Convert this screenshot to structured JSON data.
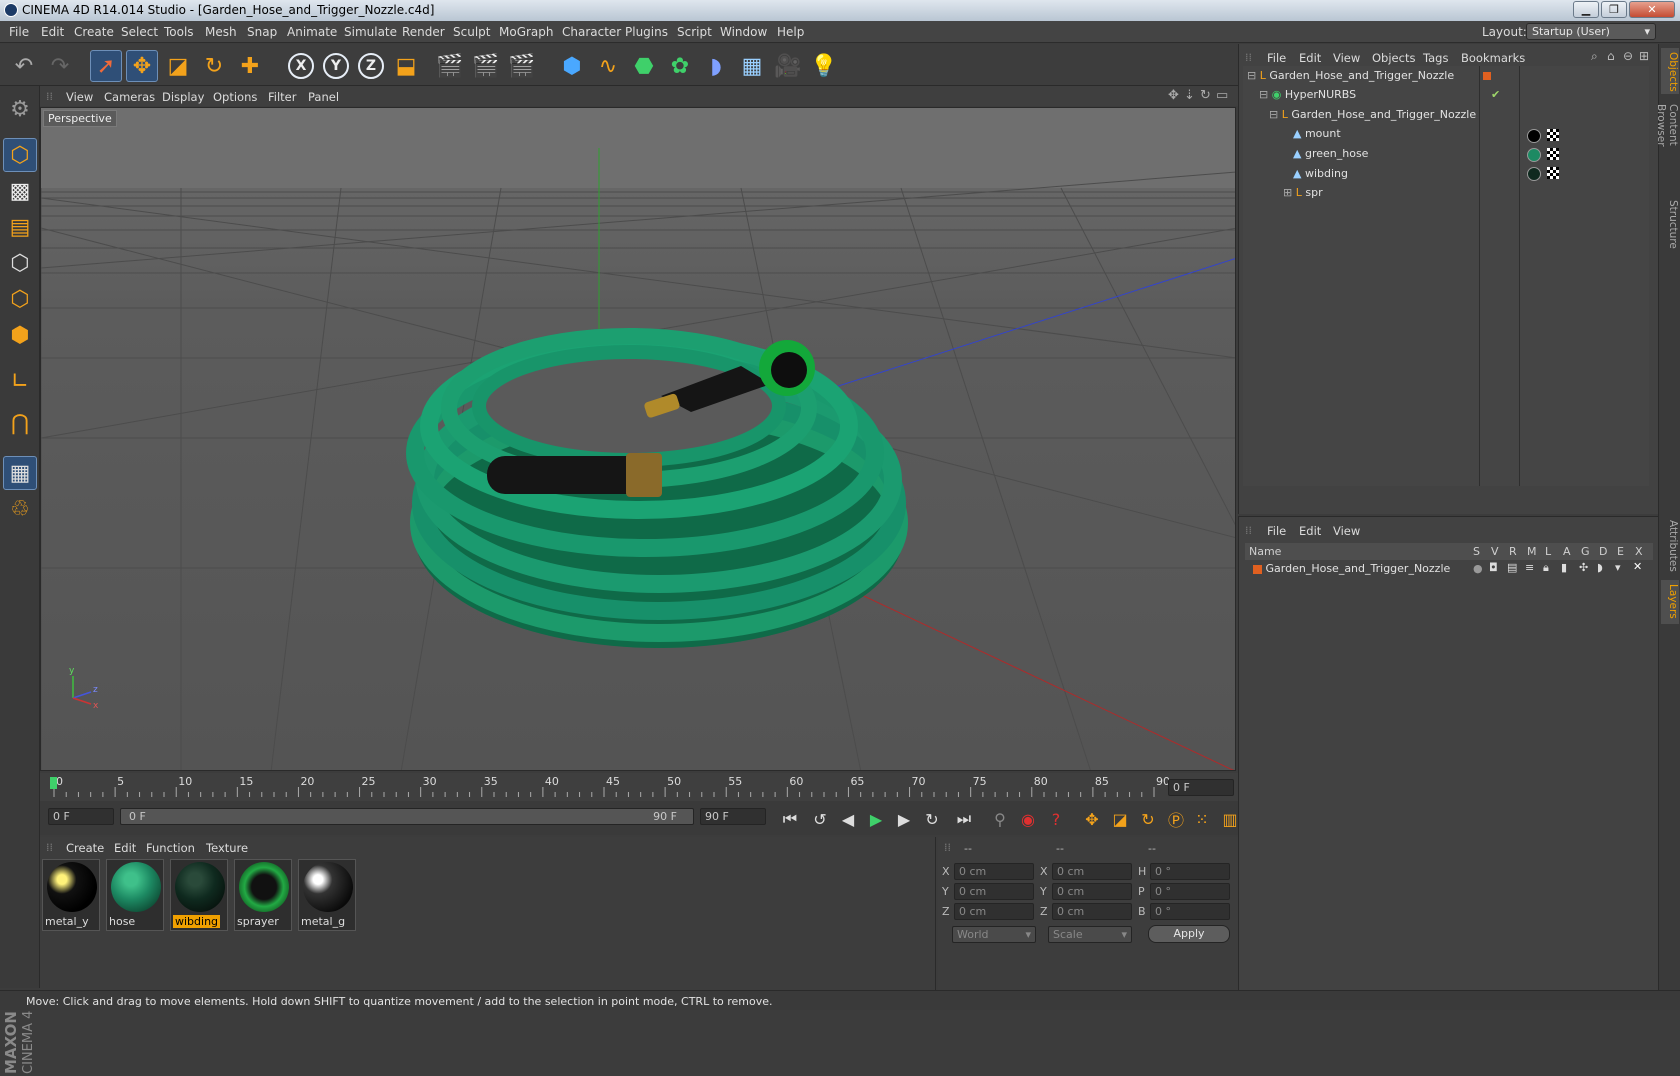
{
  "window": {
    "title": "CINEMA 4D R14.014 Studio - [Garden_Hose_and_Trigger_Nozzle.c4d]"
  },
  "menubar": {
    "items": [
      "File",
      "Edit",
      "Create",
      "Select",
      "Tools",
      "Mesh",
      "Snap",
      "Animate",
      "Simulate",
      "Render",
      "Sculpt",
      "MoGraph",
      "Character",
      "Plugins",
      "Script",
      "Window",
      "Help"
    ],
    "layout_label": "Layout:",
    "layout_value": "Startup (User)"
  },
  "toolbar": {
    "axis_x": "X",
    "axis_y": "Y",
    "axis_z": "Z"
  },
  "viewport": {
    "menu": [
      "View",
      "Cameras",
      "Display",
      "Options",
      "Filter",
      "Panel"
    ],
    "label": "Perspective",
    "axis_labels": {
      "y": "y",
      "z": "z",
      "x": "x"
    }
  },
  "timeline": {
    "ticks": [
      "0",
      "5",
      "10",
      "15",
      "20",
      "25",
      "30",
      "35",
      "40",
      "45",
      "50",
      "55",
      "60",
      "65",
      "70",
      "75",
      "80",
      "85",
      "90"
    ],
    "current_frame": "0 F",
    "start_field": "0 F",
    "range_start": "0 F",
    "range_end": "90 F",
    "end_field": "90 F"
  },
  "material_manager": {
    "menu": [
      "Create",
      "Edit",
      "Function",
      "Texture"
    ],
    "materials": [
      {
        "name": "metal_y",
        "color": "#e0c020"
      },
      {
        "name": "hose",
        "color": "#1d8a63"
      },
      {
        "name": "wibding",
        "color": "#0f2a1f",
        "selected": true
      },
      {
        "name": "sprayer",
        "color": "#22aa44"
      },
      {
        "name": "metal_g",
        "color": "#dcdcdc"
      }
    ]
  },
  "coordinates": {
    "header": [
      "--",
      "--",
      "--"
    ],
    "rows": [
      {
        "a": "X",
        "av": "0 cm",
        "b": "X",
        "bv": "0 cm",
        "c": "H",
        "cv": "0 °"
      },
      {
        "a": "Y",
        "av": "0 cm",
        "b": "Y",
        "bv": "0 cm",
        "c": "P",
        "cv": "0 °"
      },
      {
        "a": "Z",
        "av": "0 cm",
        "b": "Z",
        "bv": "0 cm",
        "c": "B",
        "cv": "0 °"
      }
    ],
    "mode1": "World",
    "mode2": "Scale",
    "apply": "Apply"
  },
  "object_manager": {
    "menu": [
      "File",
      "Edit",
      "View",
      "Objects",
      "Tags",
      "Bookmarks"
    ],
    "objects": [
      {
        "name": "Garden_Hose_and_Trigger_Nozzle",
        "indent": 0
      },
      {
        "name": "HyperNURBS",
        "indent": 1
      },
      {
        "name": "Garden_Hose_and_Trigger_Nozzle",
        "indent": 2
      },
      {
        "name": "mount",
        "indent": 3
      },
      {
        "name": "green_hose",
        "indent": 3
      },
      {
        "name": "wibding",
        "indent": 3
      },
      {
        "name": "spr",
        "indent": 3
      }
    ]
  },
  "layer_manager": {
    "menu": [
      "File",
      "Edit",
      "View"
    ],
    "columns": [
      "Name",
      "S",
      "V",
      "R",
      "M",
      "L",
      "A",
      "G",
      "D",
      "E",
      "X"
    ],
    "layers": [
      {
        "name": "Garden_Hose_and_Trigger_Nozzle",
        "color": "#e06020"
      }
    ]
  },
  "right_tabs": [
    "Objects",
    "Content Browser",
    "Structure",
    "Attributes",
    "Layers"
  ],
  "status": "Move: Click and drag to move elements. Hold down SHIFT to quantize movement / add to the selection in point mode, CTRL to remove.",
  "brand": {
    "line1": "MAXON",
    "line2": "CINEMA 4D"
  }
}
